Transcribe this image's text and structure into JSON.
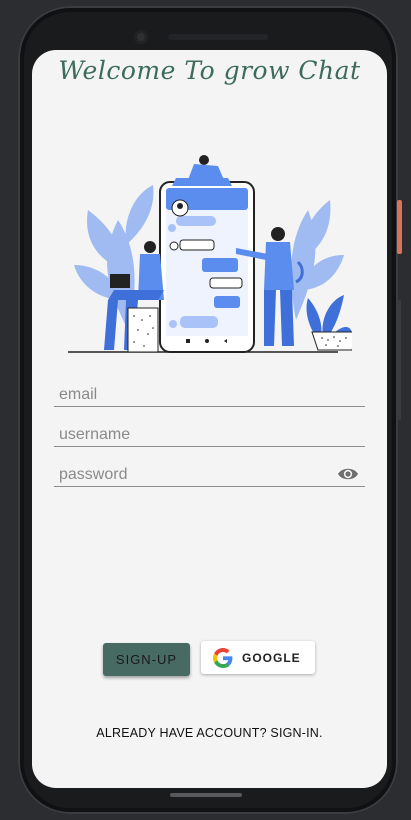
{
  "screen": {
    "title": "Welcome To grow Chat"
  },
  "form": {
    "email_placeholder": "email",
    "username_placeholder": "username",
    "password_placeholder": "password",
    "password_toggle_icon": "eye-icon"
  },
  "buttons": {
    "signup_label": "SIGN-UP",
    "google_label": "GOOGLE",
    "google_icon": "google-logo-icon"
  },
  "footer": {
    "signin_text": "ALREADY HAVE ACCOUNT? SIGN-IN."
  },
  "colors": {
    "accent": "#476b62",
    "title": "#3d6b5d",
    "illustration_blue": "#5b8def",
    "background": "#f4f4f4"
  }
}
